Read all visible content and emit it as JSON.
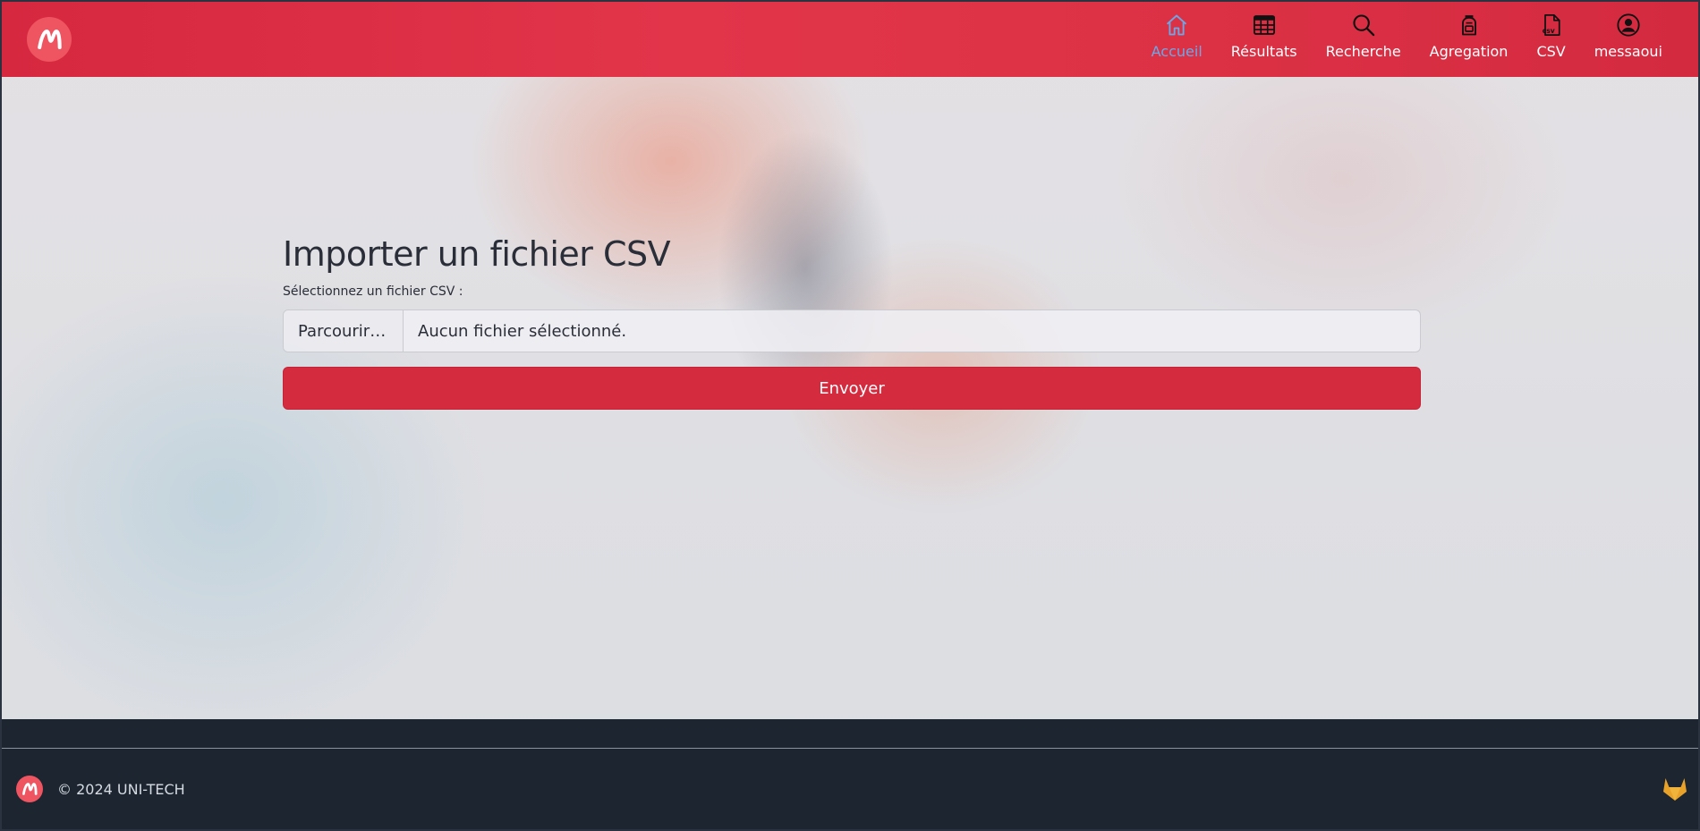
{
  "nav": {
    "items": [
      {
        "label": "Accueil",
        "icon": "home-icon",
        "active": true
      },
      {
        "label": "Résultats",
        "icon": "table-icon",
        "active": false
      },
      {
        "label": "Recherche",
        "icon": "search-icon",
        "active": false
      },
      {
        "label": "Agregation",
        "icon": "backpack-icon",
        "active": false
      },
      {
        "label": "CSV",
        "icon": "csv-file-icon",
        "active": false
      },
      {
        "label": "messaoui",
        "icon": "user-icon",
        "active": false
      }
    ],
    "csv_icon_text": "csv"
  },
  "form": {
    "title": "Importer un fichier CSV",
    "file_label": "Sélectionnez un fichier CSV :",
    "browse_label": "Parcourir…",
    "file_status": "Aucun fichier sélectionné.",
    "submit_label": "Envoyer"
  },
  "footer": {
    "copyright": "© 2024 UNI-TECH"
  },
  "colors": {
    "navbar": "#dc3145",
    "active_link": "#6aa8e8",
    "button": "#d52b3f",
    "footer": "#1d2530",
    "gitlab": "#e8a22a"
  }
}
